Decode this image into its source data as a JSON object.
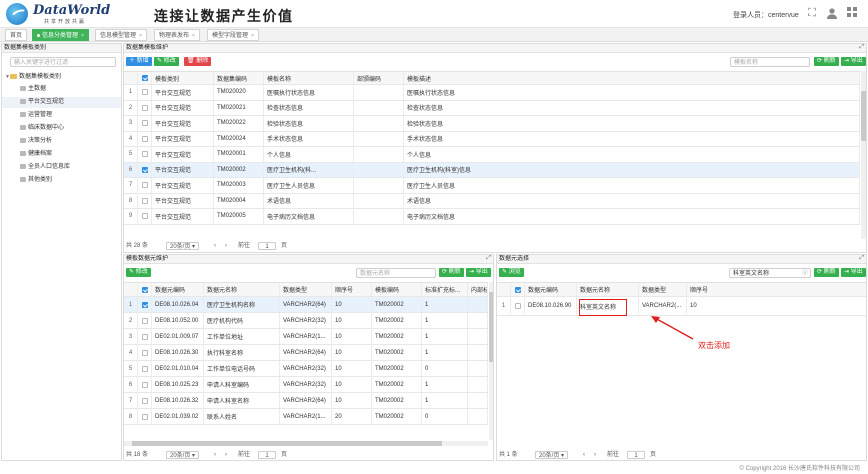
{
  "header": {
    "brand": "DataWorld",
    "brand_sub": "共享开放共赢",
    "slogan": "连接让数据产生价值",
    "user_label": "登录人员：centervue"
  },
  "tabs": [
    {
      "label": "首页"
    },
    {
      "label": "信息分类管理"
    },
    {
      "label": "信息模型管理"
    },
    {
      "label": "物理表发布"
    },
    {
      "label": "模型字段管理"
    }
  ],
  "left_panel": {
    "title": "数据集模板类别",
    "search_placeholder": "输入关键字进行过滤",
    "root": "数据集模板类别",
    "items": [
      "主数据",
      "平台交互规范",
      "运营管理",
      "临床数据中心",
      "决策分析",
      "健康档案",
      "全员人口信息库",
      "其他类别"
    ]
  },
  "top_panel": {
    "title": "数据集模板维护",
    "btn_add": "新增",
    "btn_edit": "修改",
    "btn_del": "删除",
    "search_placeholder": "模板名称",
    "btn_refresh": "刷新",
    "btn_export": "导出",
    "columns": [
      "",
      "",
      "模板类别",
      "数据集编码",
      "模板名称",
      "部颁编码",
      "模板描述"
    ],
    "rows": [
      [
        "1",
        "平台交互规范",
        "TM020020",
        "医嘱执行状态信息",
        "",
        "医嘱执行状态信息"
      ],
      [
        "2",
        "平台交互规范",
        "TM020021",
        "检查状态信息",
        "",
        "检查状态信息"
      ],
      [
        "3",
        "平台交互规范",
        "TM020022",
        "检验状态信息",
        "",
        "检验状态信息"
      ],
      [
        "4",
        "平台交互规范",
        "TM020024",
        "手术状态信息",
        "",
        "手术状态信息"
      ],
      [
        "5",
        "平台交互规范",
        "TM020001",
        "个人信息",
        "",
        "个人信息"
      ],
      [
        "6",
        "平台交互规范",
        "TM020002",
        "医疗卫生机构(科...",
        "",
        "医疗卫生机构(科室)信息"
      ],
      [
        "7",
        "平台交互规范",
        "TM020003",
        "医疗卫生人员信息",
        "",
        "医疗卫生人员信息"
      ],
      [
        "8",
        "平台交互规范",
        "TM020004",
        "术语信息",
        "",
        "术语信息"
      ],
      [
        "9",
        "平台交互规范",
        "TM020005",
        "电子病历文档信息",
        "",
        "电子病历文档信息"
      ]
    ],
    "selected_row": 5,
    "pager": {
      "total": "共 28 条",
      "size": "20条/页",
      "prev": "前往",
      "page": "1",
      "unit": "页"
    }
  },
  "bl_panel": {
    "title": "模板数据元维护",
    "btn_edit": "修改",
    "search_placeholder": "数据元名称",
    "btn_refresh": "刷新",
    "btn_export": "导出",
    "columns": [
      "",
      "",
      "数据元编码",
      "数据元名称",
      "数据类型",
      "顺序号",
      "模板编码",
      "标准扩充标...",
      "内部标识"
    ],
    "rows": [
      [
        "1",
        "DE08.10.026.04",
        "医疗卫生机构名称",
        "VARCHAR2(64)",
        "10",
        "TM020002",
        "1",
        ""
      ],
      [
        "2",
        "DE08.10.052.00",
        "医疗机构代码",
        "VARCHAR2(32)",
        "10",
        "TM020002",
        "1",
        ""
      ],
      [
        "3",
        "DE02.01.009.07",
        "工作单位地址",
        "VARCHAR2(1...",
        "10",
        "TM020002",
        "1",
        ""
      ],
      [
        "4",
        "DE08.10.026.30",
        "执行科室名称",
        "VARCHAR2(64)",
        "10",
        "TM020002",
        "1",
        ""
      ],
      [
        "5",
        "DE02.01.010.04",
        "工作单位电话号码",
        "VARCHAR2(32)",
        "10",
        "TM020002",
        "0",
        ""
      ],
      [
        "6",
        "DE08.10.025.23",
        "申请人科室编码",
        "VARCHAR2(32)",
        "10",
        "TM020002",
        "1",
        ""
      ],
      [
        "7",
        "DE08.10.026.32",
        "申请人科室名称",
        "VARCHAR2(64)",
        "10",
        "TM020002",
        "1",
        ""
      ],
      [
        "8",
        "DE02.01.039.02",
        "联系人姓名",
        "VARCHAR2(1...",
        "20",
        "TM020002",
        "0",
        ""
      ]
    ],
    "selected_row": 0,
    "pager": {
      "total": "共 18 条",
      "size": "20条/页",
      "prev": "前往",
      "page": "1",
      "unit": "页"
    }
  },
  "br_panel": {
    "title": "数据元选择",
    "btn_browse": "浏览",
    "search_value": "科室英文名称",
    "btn_refresh": "刷新",
    "btn_export": "导出",
    "columns": [
      "",
      "",
      "数据元编码",
      "数据元名称",
      "数据类型",
      "顺序号"
    ],
    "rows": [
      [
        "1",
        "DE08.10.026.90",
        "科室英文名称",
        "VARCHAR2(...",
        "10"
      ]
    ],
    "annotation": "双击添加",
    "pager": {
      "total": "共 1 条",
      "size": "20条/页",
      "prev": "前往",
      "page": "1",
      "unit": "页"
    }
  },
  "footer": "© Copyright 2016 长沙唐氏软件科技有限公司",
  "colors": {
    "green": "#36b04f",
    "blue": "#2f8fe0",
    "red": "#e2454a",
    "annot": "#e11d1d"
  }
}
